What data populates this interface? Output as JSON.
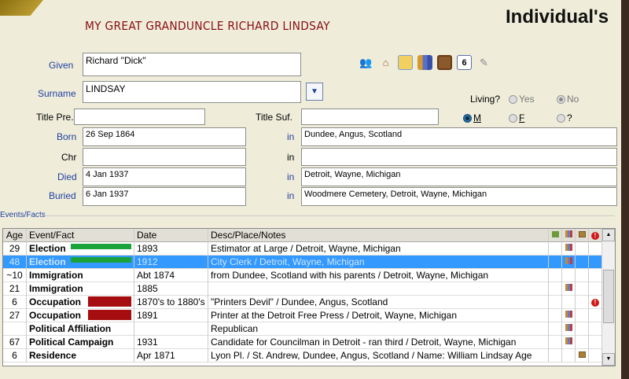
{
  "heading": "MY GREAT GRANDUNCLE RICHARD LINDSAY",
  "title": "Individual's",
  "form": {
    "given_label": "Given",
    "given": "Richard \"Dick\"",
    "surname_label": "Surname",
    "surname": "LINDSAY",
    "dropdown_icon": "▼",
    "title_pre_label": "Title Pre.",
    "title_pre": "",
    "title_suf_label": "Title Suf.",
    "title_suf": "",
    "born_label": "Born",
    "born_date": "26 Sep 1864",
    "born_place": "Dundee, Angus, Scotland",
    "chr_label": "Chr",
    "chr_date": "",
    "chr_place": "",
    "died_label": "Died",
    "died_date": "4 Jan 1937",
    "died_place": "Detroit, Wayne, Michigan",
    "buried_label": "Buried",
    "buried_date": "6 Jan 1937",
    "buried_place": "Woodmere Cemetery, Detroit, Wayne, Michigan",
    "in_label": "in",
    "living_label": "Living?",
    "yes": "Yes",
    "no": "No",
    "living": "No",
    "sex_m": "M",
    "sex_f": "F",
    "sex_u": "?",
    "sex": "M"
  },
  "toolbar_icons": [
    "people-icon",
    "house-icon",
    "notepad-icon",
    "books-icon",
    "picture-icon",
    "calendar-icon",
    "scroll-icon"
  ],
  "calendar_num": "6",
  "events": {
    "group_label": "Events/Facts",
    "headers": [
      "Age",
      "Event/Fact",
      "Date",
      "Desc/Place/Notes"
    ],
    "rows": [
      {
        "age": "29",
        "event": "Election",
        "date": "1893",
        "desc": "Estimator at Large / Detroit, Wayne, Michigan",
        "marker": "#1aa33a",
        "source": true,
        "media": false,
        "alert": false
      },
      {
        "age": "48",
        "event": "Election",
        "date": "1912",
        "desc": "City Clerk / Detroit, Wayne, Michigan",
        "marker": "#1aa33a",
        "source": true,
        "media": false,
        "alert": false,
        "selected": true
      },
      {
        "age": "~10",
        "event": "Immigration",
        "date": "Abt 1874",
        "desc": "from Dundee, Scotland with his parents / Detroit, Wayne, Michigan",
        "source": false,
        "media": false,
        "alert": false
      },
      {
        "age": "21",
        "event": "Immigration",
        "date": "1885",
        "desc": "",
        "source": true,
        "media": false,
        "alert": false
      },
      {
        "age": "6",
        "event": "Occupation",
        "date": "1870's to 1880's",
        "desc": "\"Printers Devil\" / Dundee, Angus, Scotland",
        "marker": "#a50d10",
        "source": false,
        "media": false,
        "alert": true
      },
      {
        "age": "27",
        "event": "Occupation",
        "date": "1891",
        "desc": "Printer at the Detroit Free Press / Detroit, Wayne, Michigan",
        "marker": "#a50d10",
        "source": true,
        "media": false,
        "alert": false
      },
      {
        "age": "",
        "event": "Political Affiliation",
        "date": "",
        "desc": "Republican",
        "source": true,
        "media": false,
        "alert": false
      },
      {
        "age": "67",
        "event": "Political Campaign",
        "date": "1931",
        "desc": "Candidate for Councilman in Detroit - ran third / Detroit, Wayne, Michigan",
        "source": true,
        "media": false,
        "alert": false
      },
      {
        "age": "6",
        "event": "Residence",
        "date": "Apr 1871",
        "desc": "Lyon Pl. / St. Andrew, Dundee, Angus, Scotland / Name: William Lindsay Age",
        "source": false,
        "media": true,
        "alert": false
      }
    ]
  }
}
